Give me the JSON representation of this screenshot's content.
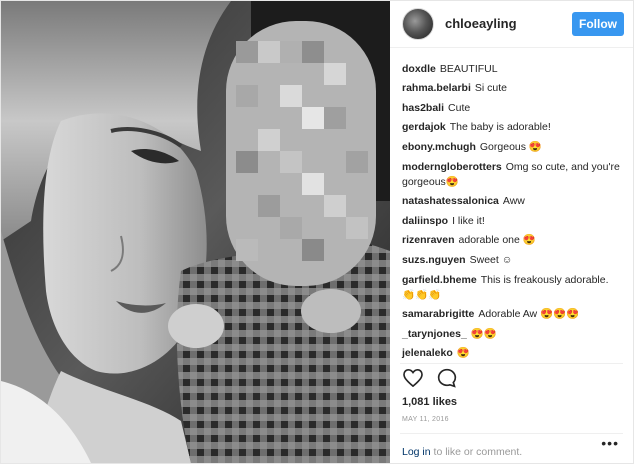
{
  "post": {
    "username": "chloeayling",
    "follow_label": "Follow",
    "likes": "1,081 likes",
    "date": "MAY 11, 2016",
    "login_link": "Log in",
    "login_rest": " to like or comment.",
    "menu": "•••"
  },
  "comments": [
    {
      "user": "doxdle",
      "text": "BEAUTIFUL"
    },
    {
      "user": "rahma.belarbi",
      "text": "Si cute"
    },
    {
      "user": "has2bali",
      "text": "Cute"
    },
    {
      "user": "gerdajok",
      "text": "The baby is adorable!"
    },
    {
      "user": "ebony.mchugh",
      "text": "Gorgeous 😍"
    },
    {
      "user": "moderngloberotters",
      "text": "Omg so cute, and you're gorgeous😍"
    },
    {
      "user": "natashatessalonica",
      "text": "Aww"
    },
    {
      "user": "daliinspo",
      "text": "I like it!"
    },
    {
      "user": "rizenraven",
      "text": "adorable one 😍"
    },
    {
      "user": "suzs.nguyen",
      "text": "Sweet ☺"
    },
    {
      "user": "garfield.bheme",
      "text": "This is freakously adorable. 👏👏👏"
    },
    {
      "user": "samarabrigitte",
      "text": "Adorable Aw 😍😍😍"
    },
    {
      "user": "_tarynjones_",
      "text": "😍😍"
    },
    {
      "user": "jelenaleko",
      "text": "😍"
    }
  ],
  "icons": {
    "like": "heart-icon",
    "comment": "comment-bubble-icon",
    "more": "more-options-icon"
  },
  "colors": {
    "follow_button": "#3897f0",
    "link": "#003569",
    "muted": "#999999"
  }
}
